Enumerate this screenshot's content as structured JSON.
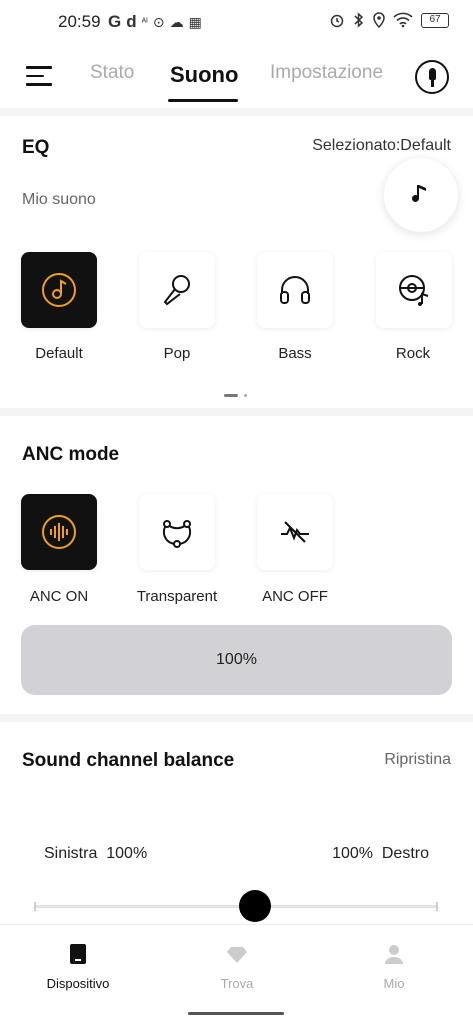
{
  "status_bar": {
    "time": "20:59",
    "left_icons": [
      "G",
      "d",
      "ᴬᴵ",
      "⊙",
      "☁",
      "▦"
    ],
    "right_icons": [
      "alarm-icon",
      "bluetooth-icon",
      "location-icon",
      "wifi-icon"
    ],
    "battery": "67"
  },
  "tabs": [
    {
      "label": "Stato",
      "active": false
    },
    {
      "label": "Suono",
      "active": true
    },
    {
      "label": "Impostazione",
      "active": false
    }
  ],
  "eq": {
    "title": "EQ",
    "selected": "Selezionato:Default",
    "subtitle": "Mio suono",
    "presets": [
      {
        "label": "Default",
        "icon": "disc-music-icon",
        "active": true
      },
      {
        "label": "Pop",
        "icon": "microphone-icon",
        "active": false
      },
      {
        "label": "Bass",
        "icon": "headphones-icon",
        "active": false
      },
      {
        "label": "Rock",
        "icon": "vinyl-music-icon",
        "active": false
      }
    ],
    "fab_icon": "music-note-icon"
  },
  "anc": {
    "title": "ANC mode",
    "modes": [
      {
        "label": "ANC ON",
        "icon": "soundwave-icon",
        "active": true
      },
      {
        "label": "Transparent",
        "icon": "transparent-icon",
        "active": false
      },
      {
        "label": "ANC OFF",
        "icon": "anc-off-icon",
        "active": false
      }
    ],
    "level": "100%"
  },
  "balance": {
    "title": "Sound channel balance",
    "reset": "Ripristina",
    "left_label": "Sinistra",
    "left_value": "100%",
    "right_value": "100%",
    "right_label": "Destro"
  },
  "bottom_nav": [
    {
      "label": "Dispositivo",
      "icon": "device-icon",
      "active": true
    },
    {
      "label": "Trova",
      "icon": "diamond-icon",
      "active": false
    },
    {
      "label": "Mio",
      "icon": "person-icon",
      "active": false
    }
  ],
  "colors": {
    "accent": "#f0a020",
    "active_tile": "#111111",
    "level_bar": "#d2d2d6"
  }
}
